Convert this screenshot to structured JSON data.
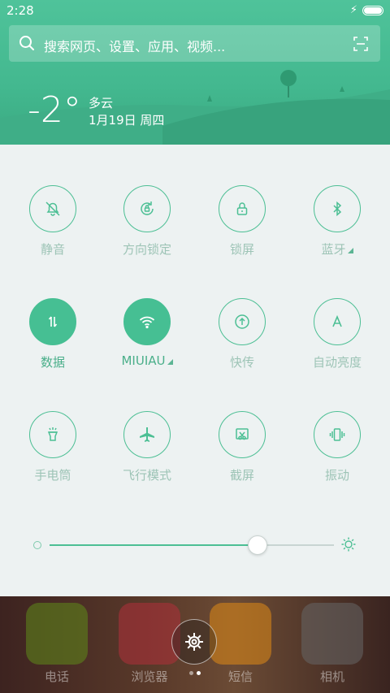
{
  "status_bar": {
    "time": "2:28"
  },
  "search": {
    "placeholder": "搜索网页、设置、应用、视频..."
  },
  "weather": {
    "temperature": "-2°",
    "condition": "多云",
    "date": "1月19日 周四"
  },
  "toggles": [
    {
      "label": "静音",
      "icon": "bell-off-icon",
      "on": false
    },
    {
      "label": "方向锁定",
      "icon": "rotation-lock-icon",
      "on": false
    },
    {
      "label": "锁屏",
      "icon": "lock-icon",
      "on": false
    },
    {
      "label": "蓝牙",
      "icon": "bluetooth-icon",
      "on": false
    },
    {
      "label": "数据",
      "icon": "mobile-data-icon",
      "on": true
    },
    {
      "label": "MIUIAU",
      "icon": "wifi-icon",
      "on": true
    },
    {
      "label": "快传",
      "icon": "quick-transfer-icon",
      "on": false
    },
    {
      "label": "自动亮度",
      "icon": "auto-brightness-icon",
      "on": false
    },
    {
      "label": "手电筒",
      "icon": "flashlight-icon",
      "on": false
    },
    {
      "label": "飞行模式",
      "icon": "airplane-icon",
      "on": false
    },
    {
      "label": "截屏",
      "icon": "screenshot-icon",
      "on": false
    },
    {
      "label": "振动",
      "icon": "vibrate-icon",
      "on": false
    }
  ],
  "brightness": {
    "level": 0.73
  },
  "dock": [
    {
      "label": "电话",
      "icon": "phone-app-icon",
      "color": "#5f8a1a"
    },
    {
      "label": "浏览器",
      "icon": "browser-app-icon",
      "color": "#b0303a"
    },
    {
      "label": "短信",
      "icon": "messages-app-icon",
      "color": "#e08a16"
    },
    {
      "label": "相机",
      "icon": "camera-app-icon",
      "color": "#666666"
    }
  ],
  "colors": {
    "accent": "#46bf93",
    "panel_bg": "#edf2f2",
    "header_bg": "#4fc39a"
  }
}
